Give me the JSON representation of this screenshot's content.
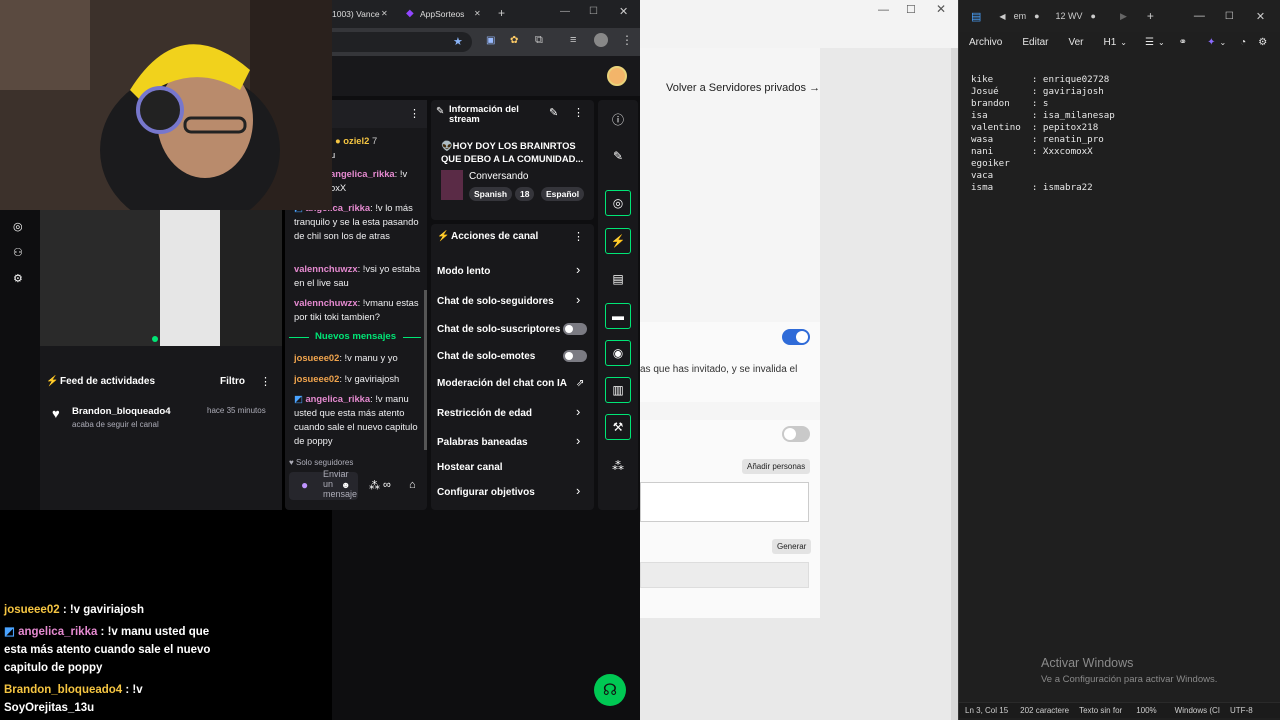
{
  "browser_tabs": [
    {
      "label": "1003) Vance"
    },
    {
      "label": "AppSorteos"
    }
  ],
  "settings_page": {
    "back_link": "Volver a Servidores privados →",
    "invite_text": "as que has invitado, y se invalida el",
    "add_people": "Añadir personas",
    "generate": "Generar"
  },
  "stream_info": {
    "header": "Información del stream",
    "title": "👽HOY DOY LOS BRAINRTOS QUE DEBO A LA COMUNIDAD...",
    "category": "Conversando",
    "tags": [
      "Spanish",
      "18",
      "Español"
    ]
  },
  "channel_actions": {
    "header": "Acciones de canal",
    "items": [
      {
        "label": "Modo lento"
      },
      {
        "label": "Chat de solo-seguidores"
      },
      {
        "label": "Chat de solo-suscriptores"
      },
      {
        "label": "Chat de solo-emotes"
      },
      {
        "label": "Moderación del chat con IA"
      },
      {
        "label": "Restricción de edad"
      },
      {
        "label": "Palabras baneadas"
      },
      {
        "label": "Hostear canal"
      },
      {
        "label": "Configurar objetivos"
      }
    ]
  },
  "chat": {
    "top_user": "oziel2",
    "top_count": "7",
    "fragment1": "u",
    "lines": [
      {
        "user": "angelica_rikka",
        "text": ": !v"
      },
      {
        "user": "",
        "text": "oxX"
      },
      {
        "user": "angelica_rikka",
        "text": ": !v lo más tranquilo y se la esta pasando de chil son los de atras"
      },
      {
        "user": "valennchuwzx",
        "text": ": !vsi yo estaba en el live sau"
      },
      {
        "user": "valennchuwzx",
        "text": ": !vmanu estas por tiki toki tambien?"
      }
    ],
    "new_messages": "Nuevos mensajes",
    "new_lines": [
      {
        "user": "josueee02",
        "text": ": !v manu y yo"
      },
      {
        "user": "josueee02",
        "text": ": !v gaviriajosh"
      },
      {
        "user": "angelica_rikka",
        "text": ": !v manu usted que esta más atento cuando sale el nuevo capitulo de poppy"
      }
    ],
    "followers_only": "Solo seguidores",
    "input_placeholder": "Enviar un mensaje"
  },
  "activity_feed": {
    "title": "Feed de actividades",
    "filter": "Filtro",
    "item_user": "Brandon_bloqueado4",
    "item_action": "acaba de seguir el canal",
    "item_time": "hace 35 minutos"
  },
  "overlay_chat": [
    {
      "user": "josueee02",
      "text": " : !v gaviriajosh"
    },
    {
      "user": "angelica_rikka",
      "text": " : !v manu usted que esta más atento cuando sale el nuevo capitulo de poppy"
    },
    {
      "user": "Brandon_bloqueado4",
      "text": " : !v SoyOrejitas_13u"
    }
  ],
  "notepad": {
    "tab_label": "em",
    "tab_label2": "12 WV",
    "menu": [
      "Archivo",
      "Editar",
      "Ver",
      "H1"
    ],
    "lines": [
      "kike       : enrique02728",
      "Josué      : gaviriajosh",
      "brandon    : s",
      "isa        : isa_milanesap",
      "valentino  : pepitox218",
      "wasa       : renatin_pro",
      "nani       : XxxcomoxX",
      "egoiker",
      "vaca",
      "isma       : ismabra22"
    ],
    "status": [
      "Ln 3, Col 15",
      "202 caractere",
      "Texto sin for",
      "100%",
      "Windows (CI",
      "UTF-8"
    ],
    "activate_title": "Activar Windows",
    "activate_sub": "Ve a Configuración para activar Windows."
  },
  "colors": {
    "twitch_green": "#00e676",
    "toggle_on": "#2f6bd8"
  }
}
